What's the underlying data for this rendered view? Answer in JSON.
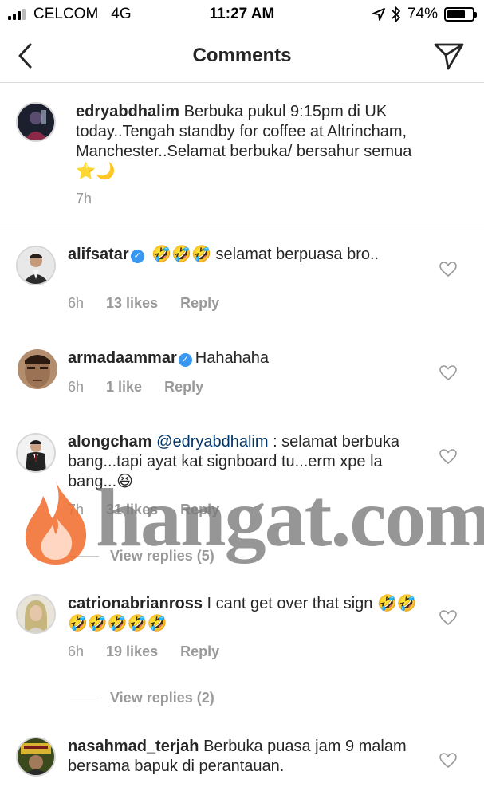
{
  "status_bar": {
    "carrier": "CELCOM",
    "network": "4G",
    "time": "11:27 AM",
    "battery_percent": "74%",
    "battery_level": 0.74,
    "icons": [
      "signal-icon",
      "location-arrow-icon",
      "bluetooth-icon",
      "battery-icon"
    ]
  },
  "nav": {
    "title": "Comments",
    "back_icon": "chevron-left-icon",
    "send_icon": "paper-plane-icon"
  },
  "caption": {
    "username": "edryabdhalim",
    "text": "Berbuka pukul 9:15pm di UK today..Tengah standby for coffee at Altrincham, Manchester..Selamat berbuka/ bersahur semua ⭐🌙",
    "time": "7h"
  },
  "comments": [
    {
      "username": "alifsatar",
      "verified": true,
      "text": "🤣🤣🤣 selamat berpuasa bro..",
      "time": "6h",
      "likes": "13 likes",
      "reply": "Reply"
    },
    {
      "username": "armadaammar",
      "verified": true,
      "text": "Hahahaha",
      "time": "6h",
      "likes": "1 like",
      "reply": "Reply"
    },
    {
      "username": "alongcham",
      "verified": false,
      "mention": "@edryabdhalim",
      "text": " : selamat berbuka bang...tapi ayat kat signboard tu...erm xpe la bang...😆",
      "time": "7h",
      "likes": "31 likes",
      "reply": "Reply",
      "view_replies": "View replies (5)"
    },
    {
      "username": "catrionabrianross",
      "verified": false,
      "text": "I cant get over that sign 🤣🤣🤣🤣🤣🤣🤣",
      "time": "6h",
      "likes": "19 likes",
      "reply": "Reply",
      "view_replies": "View replies (2)"
    },
    {
      "username": "nasahmad_terjah",
      "verified": false,
      "text": "Berbuka puasa jam 9 malam bersama bapuk di perantauan."
    }
  ],
  "watermark": {
    "brand": "hangat.com",
    "colors": {
      "flame_outer": "#f26b2a",
      "flame_inner": "#ffd0b8",
      "text": "#787878"
    }
  },
  "colors": {
    "text": "#262626",
    "meta": "#999999",
    "verified": "#3897f0",
    "divider": "#dbdbdb",
    "mention": "#003569"
  }
}
